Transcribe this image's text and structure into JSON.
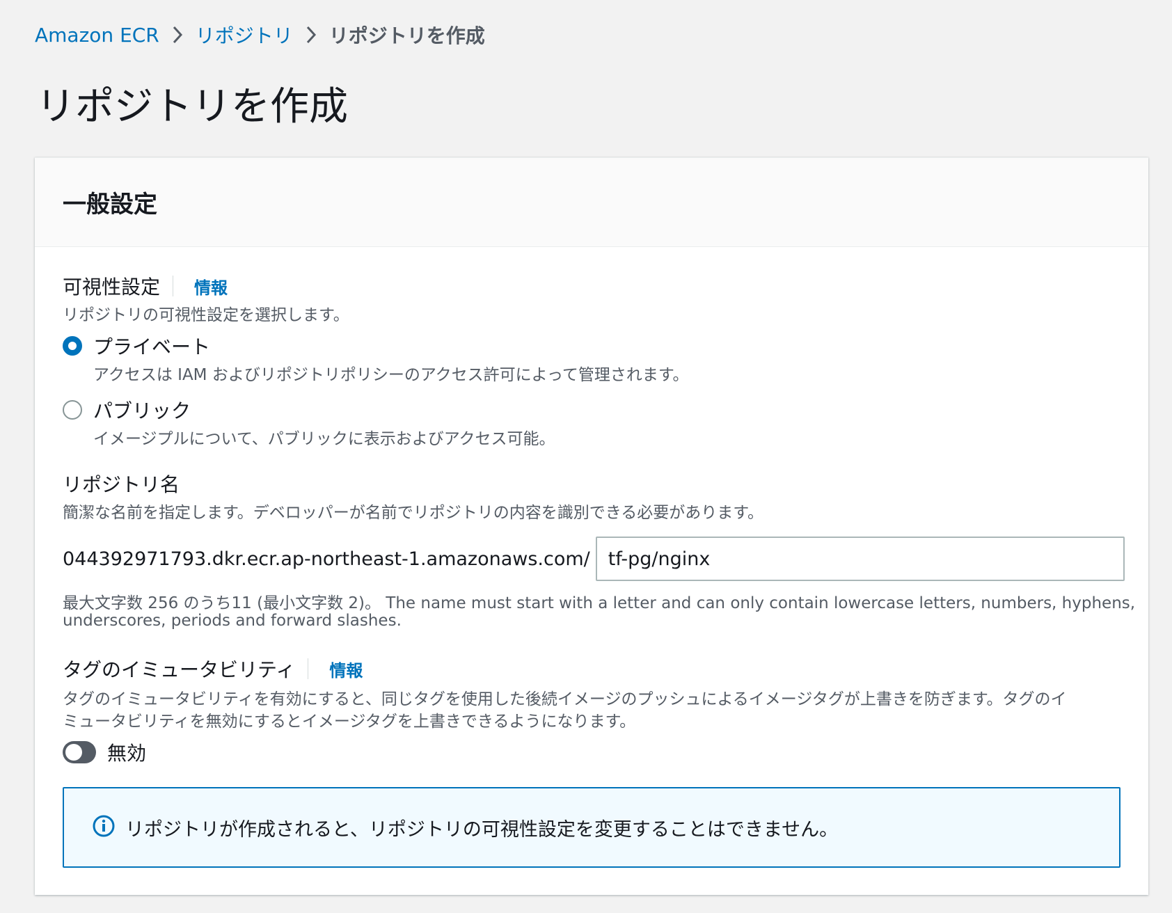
{
  "breadcrumb": {
    "items": [
      {
        "label": "Amazon ECR"
      },
      {
        "label": "リポジトリ"
      }
    ],
    "current": "リポジトリを作成"
  },
  "page": {
    "title": "リポジトリを作成"
  },
  "panel": {
    "title": "一般設定"
  },
  "visibility": {
    "label": "可視性設定",
    "info": "情報",
    "description": "リポジトリの可視性設定を選択します。",
    "options": [
      {
        "label": "プライベート",
        "description": "アクセスは IAM およびリポジトリポリシーのアクセス許可によって管理されます。",
        "selected": true
      },
      {
        "label": "パブリック",
        "description": "イメージプルについて、パブリックに表示およびアクセス可能。",
        "selected": false
      }
    ]
  },
  "repo_name": {
    "label": "リポジトリ名",
    "description": "簡潔な名前を指定します。デベロッパーが名前でリポジトリの内容を識別できる必要があります。",
    "uri_prefix": "044392971793.dkr.ecr.ap-northeast-1.amazonaws.com/",
    "value": "tf-pg/nginx",
    "constraint_1": "最大文字数 256 のうち11 (最小文字数 2)。 The name must start with a letter and can only contain lowercase letters, numbers, hyphens,",
    "constraint_2": "underscores, periods and forward slashes."
  },
  "tag_immutability": {
    "label": "タグのイミュータビリティ",
    "info": "情報",
    "description_1": "タグのイミュータビリティを有効にすると、同じタグを使用した後続イメージのプッシュによるイメージタグが上書きを防ぎます。タグのイ",
    "description_2": "ミュータビリティを無効にするとイメージタグを上書きできるようになります。",
    "toggle_label": "無効",
    "enabled": false
  },
  "alert": {
    "text": "リポジトリが作成されると、リポジトリの可視性設定を変更することはできません。"
  },
  "colors": {
    "link": "#0073bb",
    "text": "#16191f",
    "secondary": "#545b64",
    "background": "#f2f2f2"
  }
}
